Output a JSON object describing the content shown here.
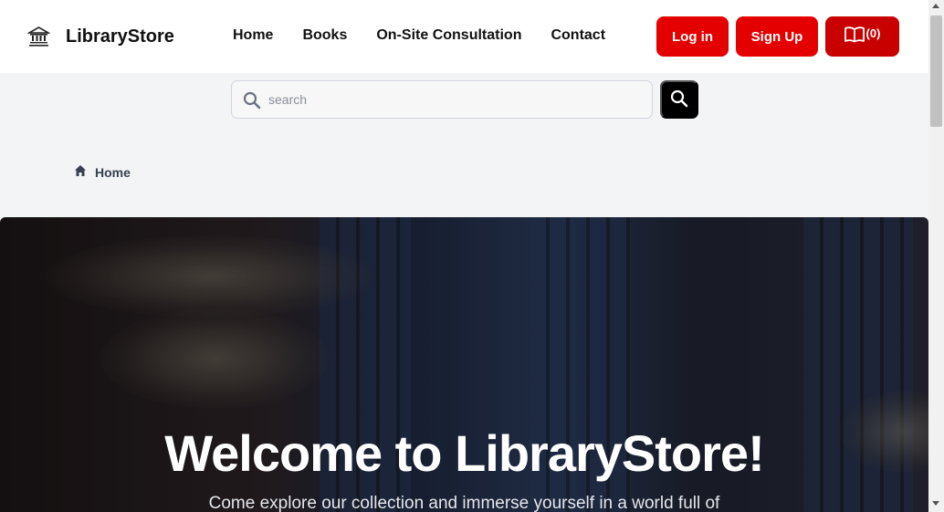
{
  "header": {
    "brand": "LibraryStore",
    "logo_icon": "library-building-icon",
    "nav": [
      "Home",
      "Books",
      "On-Site Consultation",
      "Contact"
    ],
    "login_label": "Log in",
    "signup_label": "Sign Up",
    "cart_icon": "open-book-icon",
    "cart_count": "(0)"
  },
  "search": {
    "placeholder": "search",
    "value": "",
    "icon": "search-icon",
    "button_icon": "search-icon"
  },
  "breadcrumb": {
    "icon": "home-icon",
    "label": "Home"
  },
  "hero": {
    "title": "Welcome to LibraryStore!",
    "subtitle": "Come explore our collection and immerse yourself in a world full of"
  },
  "colors": {
    "accent": "#e50000",
    "accent_dark": "#c80000",
    "page_bg": "#f3f4f6",
    "header_bg": "#ffffff"
  }
}
